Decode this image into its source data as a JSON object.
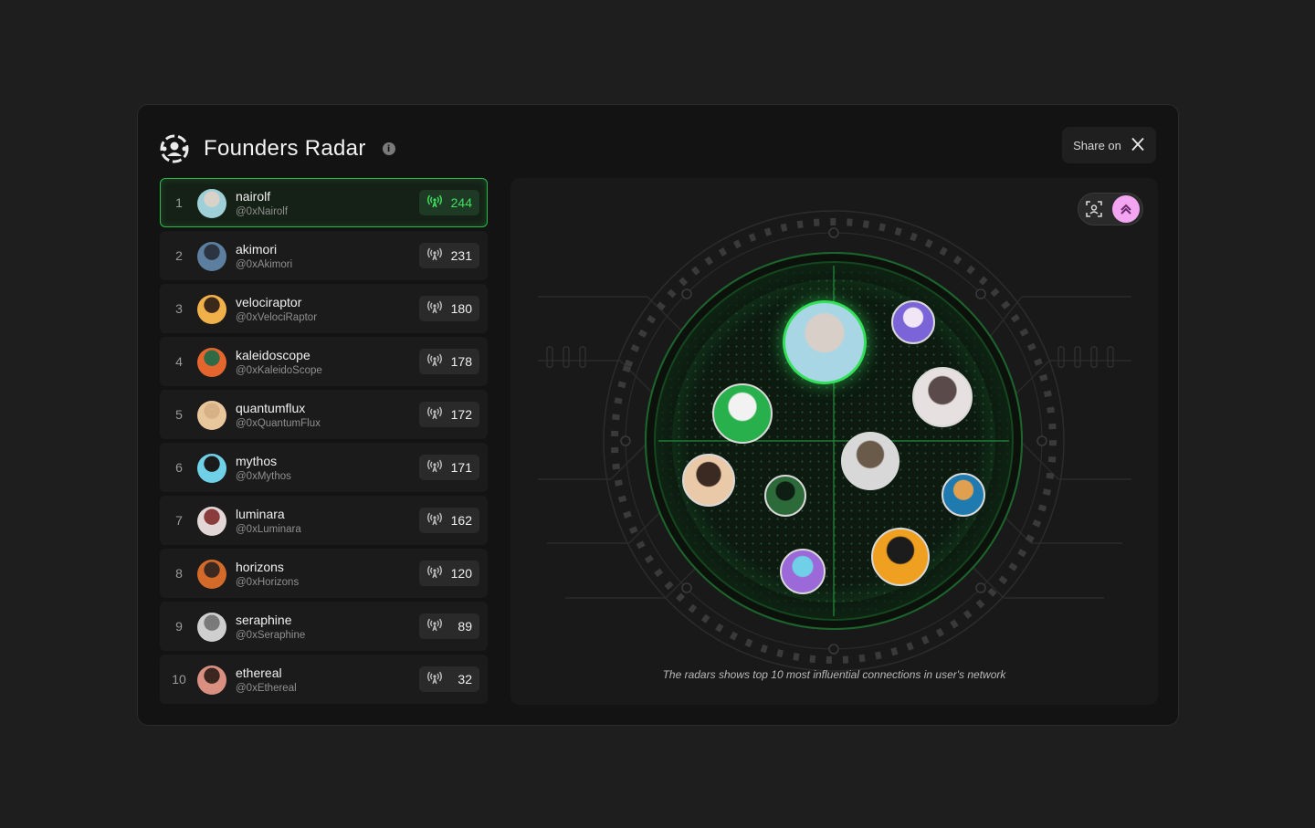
{
  "header": {
    "title": "Founders Radar",
    "share_label": "Share on"
  },
  "leaderboard": [
    {
      "rank": "1",
      "name": "nairolf",
      "handle": "@0xNairolf",
      "score": "244",
      "colors": [
        "#9fd0d8",
        "#d9d2c8"
      ]
    },
    {
      "rank": "2",
      "name": "akimori",
      "handle": "@0xAkimori",
      "score": "231",
      "colors": [
        "#5c7fa0",
        "#2b3440"
      ]
    },
    {
      "rank": "3",
      "name": "velociraptor",
      "handle": "@0xVelociRaptor",
      "score": "180",
      "colors": [
        "#f0b04a",
        "#3b2a1c"
      ]
    },
    {
      "rank": "4",
      "name": "kaleidoscope",
      "handle": "@0xKaleidoScope",
      "score": "178",
      "colors": [
        "#e4662e",
        "#2f6a44"
      ]
    },
    {
      "rank": "5",
      "name": "quantumflux",
      "handle": "@0xQuantumFlux",
      "score": "172",
      "colors": [
        "#e8c79c",
        "#d7b286"
      ]
    },
    {
      "rank": "6",
      "name": "mythos",
      "handle": "@0xMythos",
      "score": "171",
      "colors": [
        "#6fd0e8",
        "#1b1b1b"
      ]
    },
    {
      "rank": "7",
      "name": "luminara",
      "handle": "@0xLuminara",
      "score": "162",
      "colors": [
        "#e3d6d6",
        "#8a3c3c"
      ]
    },
    {
      "rank": "8",
      "name": "horizons",
      "handle": "@0xHorizons",
      "score": "120",
      "colors": [
        "#d46a2a",
        "#3c2a20"
      ]
    },
    {
      "rank": "9",
      "name": "seraphine",
      "handle": "@0xSeraphine",
      "score": "89",
      "colors": [
        "#cfcfcf",
        "#7a7a7a"
      ]
    },
    {
      "rank": "10",
      "name": "ethereal",
      "handle": "@0xEthereal",
      "score": "32",
      "colors": [
        "#d99080",
        "#3b2620"
      ]
    }
  ],
  "radar": {
    "caption": "The radars shows top 10 most influential connections in user's network",
    "accent": "#33e05a",
    "toggle_active_color": "#f3a5f2"
  }
}
